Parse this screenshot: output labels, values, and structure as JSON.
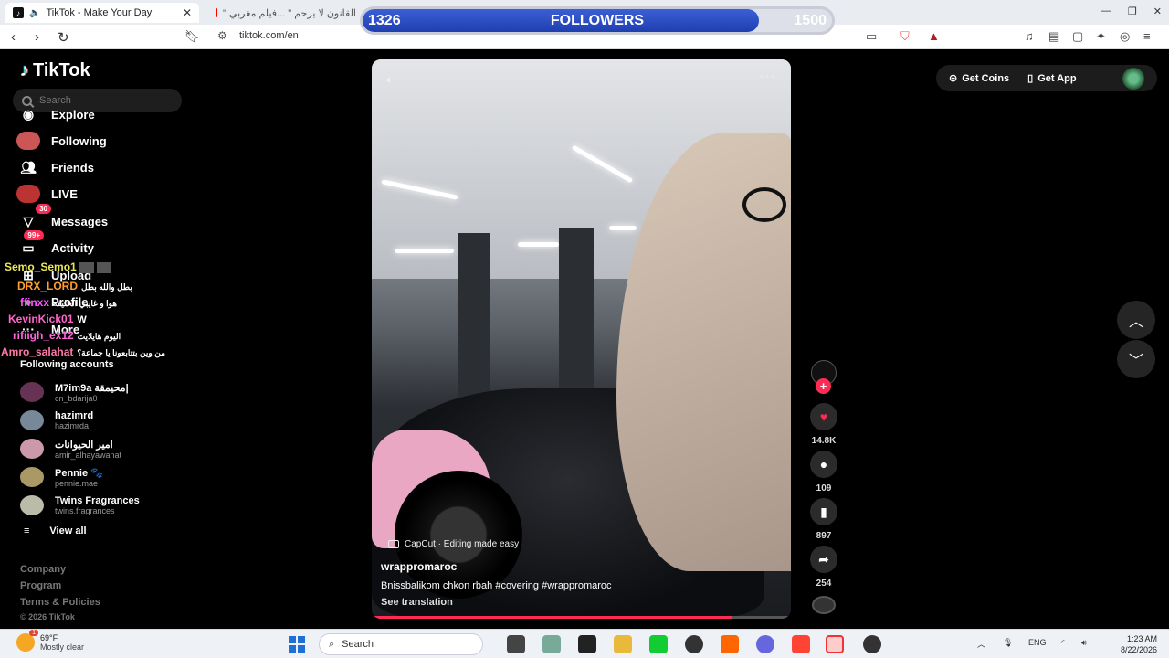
{
  "browser": {
    "active_tab_title": "TikTok - Make Your Day",
    "second_tab_title": "\" القانون لا يرحم \" ...فيلم مغربي",
    "url": "tiktok.com/en"
  },
  "overlay": {
    "current": "1326",
    "label": "FOLLOWERS",
    "goal": "1500",
    "fill_fraction": 0.845
  },
  "sidebar": {
    "logo": "TikTok",
    "search_placeholder": "Search",
    "items": [
      {
        "label": "Explore",
        "icon": "compass-icon"
      },
      {
        "label": "Following",
        "icon": "following-icon"
      },
      {
        "label": "Friends",
        "icon": "friends-icon"
      },
      {
        "label": "LIVE",
        "icon": "live-icon"
      },
      {
        "label": "Messages",
        "icon": "messages-icon",
        "badge": "30"
      },
      {
        "label": "Activity",
        "icon": "activity-icon",
        "badge": "99+"
      },
      {
        "label": "Upload",
        "icon": "upload-icon"
      },
      {
        "label": "Profile",
        "icon": "profile-icon"
      },
      {
        "label": "More",
        "icon": "more-icon"
      }
    ],
    "following_title": "Following accounts",
    "accounts": [
      {
        "name": "M7im9a محيمقة|",
        "handle": "cn_bdarija0"
      },
      {
        "name": "hazimrd",
        "handle": "hazimrda"
      },
      {
        "name": "امير الحيوانات",
        "handle": "amir_alhayawanat"
      },
      {
        "name": "Pennie 🐾",
        "handle": "pennie.mae"
      },
      {
        "name": "Twins Fragrances",
        "handle": "twins.fragrances"
      }
    ],
    "view_all": "View all",
    "footer": {
      "company": "Company",
      "program": "Program",
      "terms": "Terms & Policies",
      "copyright": "© 2026 TikTok"
    }
  },
  "chat": [
    {
      "user": "Semo_Semo1",
      "msg": "",
      "color": "#e8e85a"
    },
    {
      "user": "DRX_LORD",
      "msg": "بطل والله بطل",
      "color": "#ff9d2e"
    },
    {
      "user": "ffinxx",
      "msg": "هوا و غايبي الخليفة",
      "color": "#ff55ff"
    },
    {
      "user": "KevinKick01",
      "msg": "W",
      "color": "#ff66cc"
    },
    {
      "user": "rifiigh_ex12",
      "msg": "اليوم هايلايت",
      "color": "#ff66dd"
    },
    {
      "user": "Amro_salahat",
      "msg": "من وين بتتابعونا يا جماعة؟",
      "color": "#ff77aa"
    }
  ],
  "video": {
    "badge": "CapCut · Editing made easy",
    "username": "wrappromaroc",
    "caption": "Bnissbalikom chkon rbah #covering #wrappromaroc",
    "see_translation": "See translation",
    "progress_fraction": 0.86
  },
  "actions": {
    "likes": "14.8K",
    "comments": "109",
    "saves": "897",
    "shares": "254"
  },
  "topright": {
    "get_coins": "Get Coins",
    "get_app": "Get App"
  },
  "taskbar": {
    "temp": "69°F",
    "weather": "Mostly clear",
    "weather_badge": "1",
    "search": "Search",
    "lang": "ENG",
    "time": "1:23 AM",
    "date": "8/22/2026"
  }
}
